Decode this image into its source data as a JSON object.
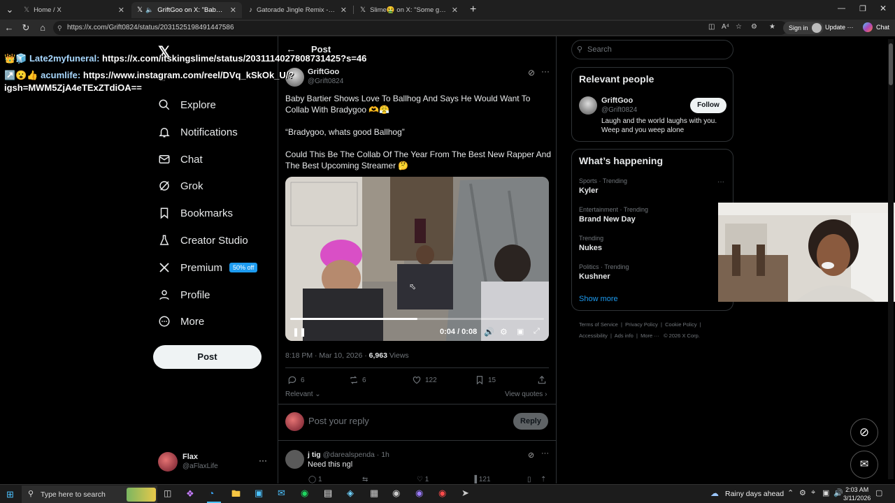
{
  "browser": {
    "tabs": [
      {
        "label": "Home / X",
        "icon": "x-logo-icon",
        "active": false
      },
      {
        "label": "GriftGoo on X: \"Baby Bartier S",
        "icon": "x-logo-icon",
        "active": true
      },
      {
        "label": "Gatorade Jingle Remix - A Fun Twi",
        "icon": "tiktok-icon",
        "active": false
      },
      {
        "label": "Slime🤮 on X: \"Some girls led Yun",
        "icon": "x-logo-icon",
        "active": false
      }
    ],
    "new_tab": "+",
    "url": "https://x.com/Grift0824/status/2031525198491447586",
    "sign_in": "Sign in",
    "update": "Update",
    "chat": "Chat"
  },
  "overlay": {
    "line1_name": "👑🧊 Late2myfuneral:",
    "line1_text": "https://x.com/itskingslime/status/2031114027808731425?s=46",
    "line2_name": "↗️😮👍 acumlife:",
    "line2_text": "https://www.instagram.com/reel/DVq_kSkOk_U/?",
    "line3_text": "igsh=MWM5ZjA4eTExZTdiOA=="
  },
  "nav": {
    "items": [
      {
        "label": "Explore",
        "icon": "search-icon"
      },
      {
        "label": "Notifications",
        "icon": "bell-icon"
      },
      {
        "label": "Chat",
        "icon": "mail-icon"
      },
      {
        "label": "Grok",
        "icon": "grok-icon"
      },
      {
        "label": "Bookmarks",
        "icon": "bookmark-icon"
      },
      {
        "label": "Creator Studio",
        "icon": "flask-icon"
      },
      {
        "label": "Premium",
        "icon": "x-logo-icon"
      },
      {
        "label": "Profile",
        "icon": "person-icon"
      },
      {
        "label": "More",
        "icon": "more-circle-icon"
      }
    ],
    "premium_badge": "50% off",
    "post_button": "Post",
    "account_name": "Flax",
    "account_handle": "@aFlaxLife"
  },
  "post": {
    "header_title": "Post",
    "author_name": "GriftGoo",
    "author_handle": "@Grift0824",
    "text1": "Baby Bartier Shows Love To Ballhog And Says He Would Want To Collab With Bradygoo 🫶😤",
    "text2": "“Bradygoo, whats good Ballhog”",
    "text3": "Could This Be The Collab Of The Year From The Best New Rapper And The Best Upcoming Streamer 🤔",
    "video_time": "0:04 / 0:08",
    "video_progress": 0.5,
    "timestamp": "8:18 PM · Mar 10, 2026 ·",
    "views_count": "6,963",
    "views_label": "Views",
    "replies": "6",
    "reposts": "6",
    "likes": "122",
    "bookmarks": "15",
    "sort_label": "Relevant",
    "view_quotes": "View quotes",
    "reply_placeholder": "Post your reply",
    "reply_button": "Reply"
  },
  "reply": {
    "name": "j tig",
    "handle": "@darealspenda · 1h",
    "text": "Need this ngl",
    "replies": "1",
    "likes": "1",
    "views": "121"
  },
  "sidebar": {
    "search_placeholder": "Search",
    "relevant_title": "Relevant people",
    "person_name": "GriftGoo",
    "person_handle": "@Grift0824",
    "person_bio": "Laugh and the world laughs with you. Weep and you weep alone",
    "follow_label": "Follow",
    "happening_title": "What’s happening",
    "trends": [
      {
        "category": "Sports · Trending",
        "title": "Kyler"
      },
      {
        "category": "Entertainment · Trending",
        "title": "Brand New Day"
      },
      {
        "category": "Trending",
        "title": "Nukes"
      },
      {
        "category": "Politics · Trending",
        "title": "Kushner"
      }
    ],
    "show_more": "Show more",
    "footer": [
      "Terms of Service",
      "Privacy Policy",
      "Cookie Policy",
      "Accessibility",
      "Ads info",
      "More ···",
      "© 2026 X Corp."
    ]
  },
  "taskbar": {
    "search_placeholder": "Type here to search",
    "weather": "Rainy days ahead",
    "time": "2:03 AM",
    "date": "3/11/2026"
  },
  "colors": {
    "accent": "#1d9bf0",
    "background": "#000000",
    "muted": "#71767b",
    "border": "#2f3336"
  }
}
